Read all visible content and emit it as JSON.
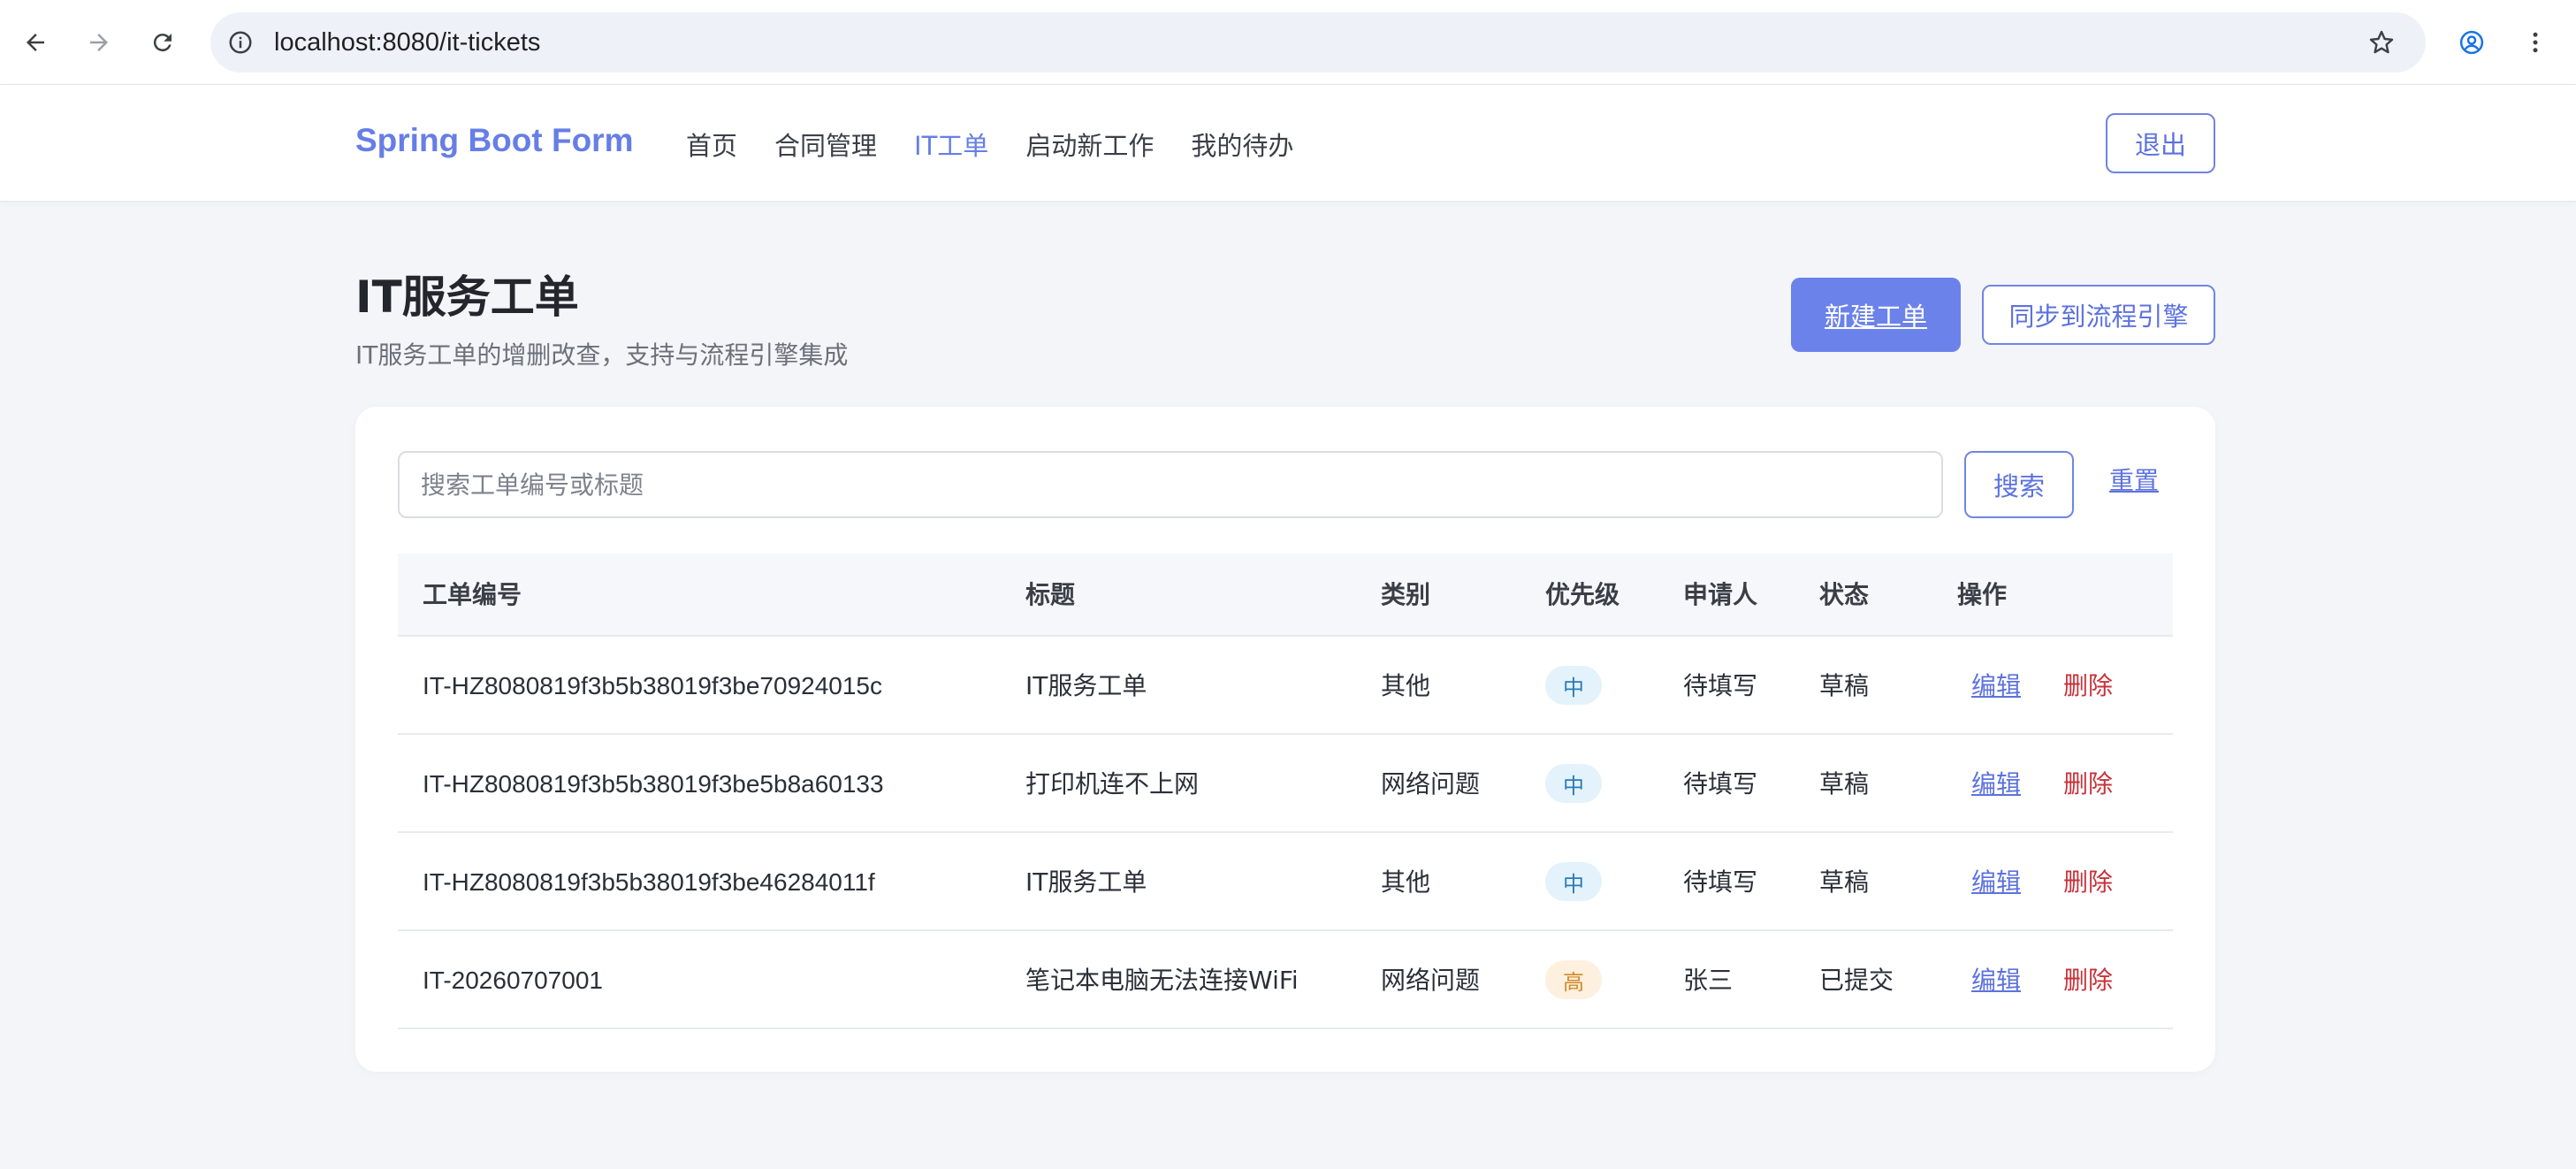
{
  "browser": {
    "url": "localhost:8080/it-tickets",
    "icons": [
      "back-arrow-icon",
      "forward-arrow-icon",
      "reload-icon",
      "info-icon",
      "star-icon",
      "account-icon",
      "kebab-menu-icon"
    ]
  },
  "navbar": {
    "brand": "Spring Boot Form",
    "items": [
      {
        "label": "首页",
        "active": false
      },
      {
        "label": "合同管理",
        "active": false
      },
      {
        "label": "IT工单",
        "active": true
      },
      {
        "label": "启动新工作",
        "active": false
      },
      {
        "label": "我的待办",
        "active": false
      }
    ],
    "logout_label": "退出"
  },
  "page": {
    "title": "IT服务工单",
    "subtitle": "IT服务工单的增删改查，支持与流程引擎集成",
    "new_ticket_label": "新建工单",
    "sync_label": "同步到流程引擎"
  },
  "search": {
    "placeholder": "搜索工单编号或标题",
    "value": "",
    "search_label": "搜索",
    "reset_label": "重置"
  },
  "table": {
    "headers": [
      "工单编号",
      "标题",
      "类别",
      "优先级",
      "申请人",
      "状态",
      "操作"
    ],
    "rows": [
      {
        "id": "IT-HZ8080819f3b5b38019f3be70924015c",
        "title": "IT服务工单",
        "category": "其他",
        "priority": "中",
        "applicant": "待填写",
        "status": "草稿",
        "edit": "编辑",
        "delete": "删除"
      },
      {
        "id": "IT-HZ8080819f3b5b38019f3be5b8a60133",
        "title": "打印机连不上网",
        "category": "网络问题",
        "priority": "中",
        "applicant": "待填写",
        "status": "草稿",
        "edit": "编辑",
        "delete": "删除"
      },
      {
        "id": "IT-HZ8080819f3b5b38019f3be46284011f",
        "title": "IT服务工单",
        "category": "其他",
        "priority": "中",
        "applicant": "待填写",
        "status": "草稿",
        "edit": "编辑",
        "delete": "删除"
      },
      {
        "id": "IT-20260707001",
        "title": "笔记本电脑无法连接WiFi",
        "category": "网络问题",
        "priority": "高",
        "applicant": "张三",
        "status": "已提交",
        "edit": "编辑",
        "delete": "删除"
      }
    ]
  },
  "colors": {
    "accent": "#667ee6",
    "danger": "#c8323a",
    "priority_mid_bg": "#e3f2fb",
    "priority_high_bg": "#fdf0de"
  }
}
